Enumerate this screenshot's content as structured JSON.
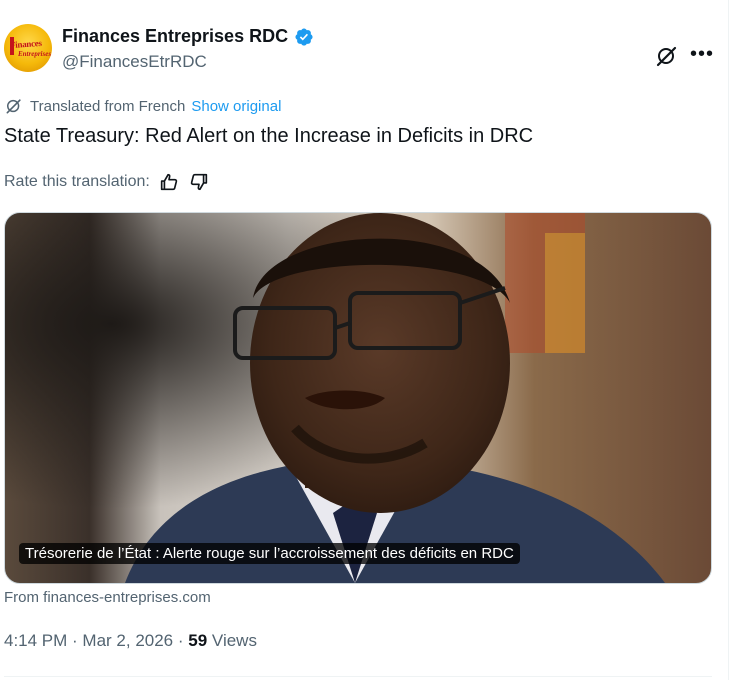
{
  "author": {
    "display_name": "Finances Entreprises RDC",
    "handle": "@FinancesEtrRDC",
    "verified_icon": "verified-badge-icon",
    "avatar_logo_text": [
      "Finances",
      "Entreprises"
    ]
  },
  "header_actions": {
    "grok_icon": "grok-icon",
    "more_label": "•••"
  },
  "translation": {
    "icon": "translate-icon",
    "label": "Translated from French",
    "show_original": "Show original"
  },
  "tweet": {
    "text": "State Treasury: Red Alert on the Increase in Deficits in DRC"
  },
  "rate": {
    "label": "Rate this translation:",
    "up_icon": "thumbs-up-icon",
    "down_icon": "thumbs-down-icon"
  },
  "card": {
    "caption": "Trésorerie de l’État : Alerte rouge sur l’accroissement des déficits en RDC",
    "from": "From finances-entreprises.com"
  },
  "meta": {
    "time": "4:14 PM",
    "separator": " · ",
    "date": "Mar 2, 2026",
    "views_count": "59",
    "views_label": " Views"
  },
  "colors": {
    "text_primary": "#0f1419",
    "text_secondary": "#536471",
    "link": "#1d9bf0",
    "verified": "#1d9bf0",
    "border": "#cfd9de"
  }
}
